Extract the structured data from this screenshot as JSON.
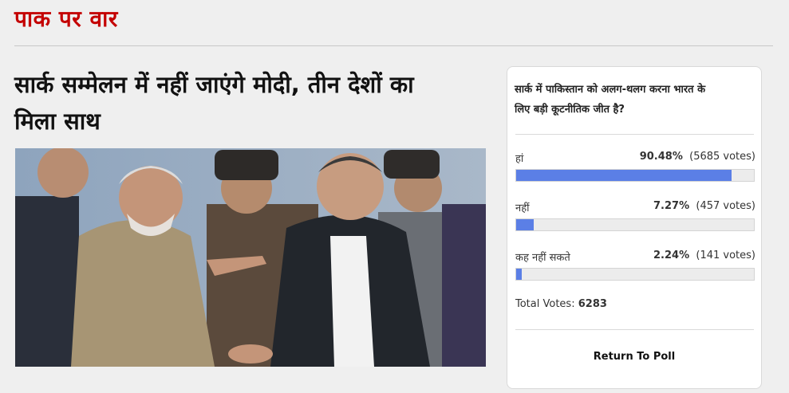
{
  "section": {
    "title": "पाक पर वार"
  },
  "article": {
    "headline_line1": "सार्क सम्मेलन में नहीं जाएंगे मोदी, तीन देशों का",
    "headline_line2": "मिला साथ"
  },
  "poll": {
    "question_line1": "सार्क में पाकिस्तान को अलग-थलग करना भारत के",
    "question_line2": "लिए बड़ी कूटनीतिक जीत है?",
    "accent_color": "#5b7fe6",
    "options": [
      {
        "label": "हां",
        "percent": "90.48%",
        "votes": "(5685 votes)",
        "fraction": 0.9048
      },
      {
        "label": "नहीं",
        "percent": "7.27%",
        "votes": "(457 votes)",
        "fraction": 0.0727
      },
      {
        "label": "कह नहीं सकते",
        "percent": "2.24%",
        "votes": "(141 votes)",
        "fraction": 0.0224
      }
    ],
    "total_label": "Total Votes:",
    "total_value": "6283",
    "return_label": "Return To Poll"
  }
}
